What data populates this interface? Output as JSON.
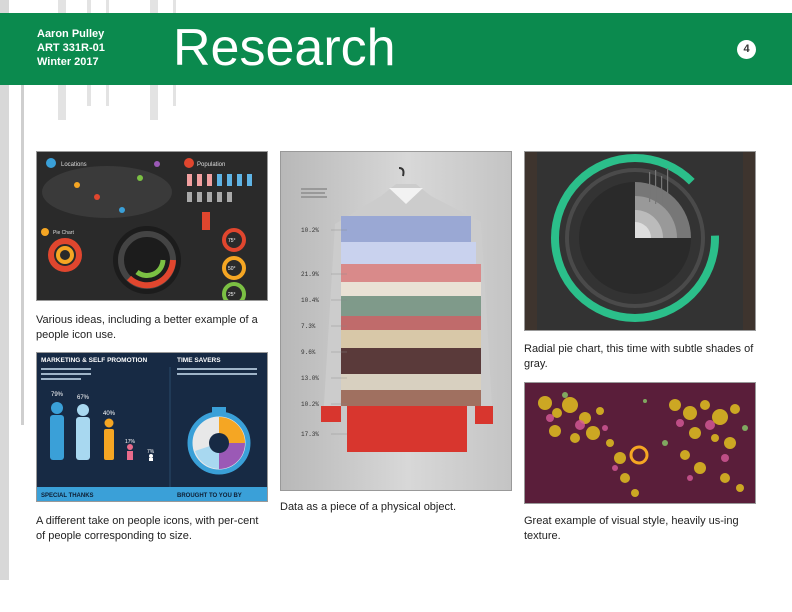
{
  "header": {
    "author": "Aaron Pulley",
    "course": "ART 331R-01",
    "term": "Winter 2017",
    "title": "Research",
    "page_number": "4"
  },
  "colors": {
    "brand_green": "#0b8a4e",
    "accent_teal": "#2bbf8a"
  },
  "examples": [
    {
      "caption": "Various ideas, including a better example of a people icon use.",
      "labels": {
        "locations": "Locations",
        "population": "Population",
        "pie_chart": "Pie Chart",
        "pct_a": "75°",
        "pct_b": "50°",
        "pct_c": "25°"
      }
    },
    {
      "caption": "A different take on people icons, with per-cent of people corresponding to size.",
      "labels": {
        "heading_left": "MARKETING & SELF PROMOTION",
        "heading_right": "TIME SAVERS",
        "p1": "79%",
        "p2": "67%",
        "p3": "40%",
        "p4": "17%",
        "p5": "7%",
        "footer_left": "SPECIAL THANKS",
        "footer_right": "BROUGHT TO YOU BY"
      }
    },
    {
      "caption": "Data as a piece of a physical object.",
      "stats": [
        "10.2%",
        "21.9%",
        "10.4%",
        "7.3%",
        "9.6%",
        "13.0%",
        "10.2%",
        "17.3%"
      ]
    },
    {
      "caption": "Radial pie chart, this time with subtle shades of gray."
    },
    {
      "caption": "Great example of visual style, heavily us-ing texture."
    }
  ]
}
